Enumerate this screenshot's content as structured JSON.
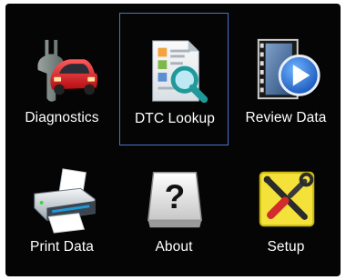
{
  "menu": {
    "items": [
      {
        "label": "Diagnostics",
        "icon": "car-wrench-icon"
      },
      {
        "label": "DTC Lookup",
        "icon": "document-magnifier-icon",
        "selected": true
      },
      {
        "label": "Review Data",
        "icon": "play-film-icon"
      },
      {
        "label": "Print Data",
        "icon": "printer-icon"
      },
      {
        "label": "About",
        "icon": "question-key-icon"
      },
      {
        "label": "Setup",
        "icon": "tools-icon"
      }
    ]
  },
  "colors": {
    "background": "#050505",
    "selection_border": "#4a73c9",
    "text": "#ffffff"
  }
}
